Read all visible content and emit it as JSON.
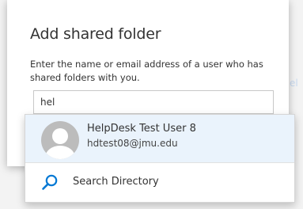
{
  "background": {
    "partial_link_text": "el"
  },
  "dialog": {
    "title": "Add shared folder",
    "instructions": "Enter the name or email address of a user who has shared folders with you.",
    "input_value": "hel"
  },
  "suggestions": [
    {
      "name": "HelpDesk Test User 8",
      "email": "hdtest08@jmu.edu",
      "highlighted": true
    }
  ],
  "search_directory": {
    "label": "Search Directory",
    "icon": "search-icon"
  },
  "colors": {
    "accent": "#0078d4",
    "highlight_bg": "#eaf3fc",
    "avatar_bg": "#bcbcbc"
  }
}
